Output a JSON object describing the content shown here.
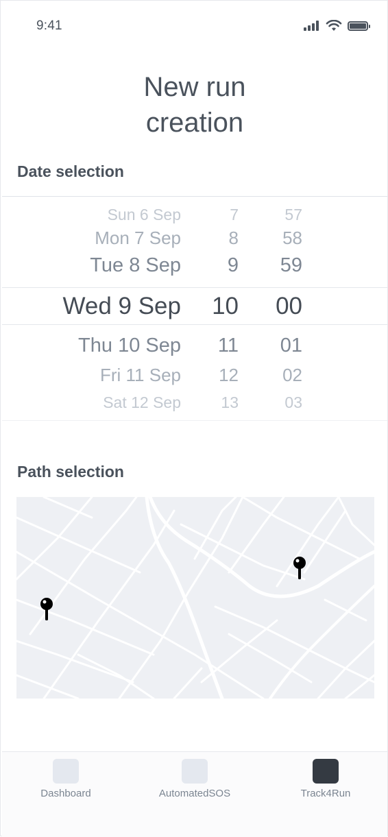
{
  "status_bar": {
    "time": "9:41"
  },
  "header": {
    "title": "New run\ncreation"
  },
  "date_section": {
    "heading": "Date selection"
  },
  "picker": {
    "rows": [
      {
        "date": "Sun 6 Sep",
        "hour": "7",
        "minute": "57",
        "color": "#c3c9d1",
        "size": 23
      },
      {
        "date": "Mon 7 Sep",
        "hour": "8",
        "minute": "58",
        "color": "#a7afb9",
        "size": 26
      },
      {
        "date": "Tue 8 Sep",
        "hour": "9",
        "minute": "59",
        "color": "#7e8793",
        "size": 29
      },
      {
        "date": "Wed 9 Sep",
        "hour": "10",
        "minute": "00",
        "color": "#454c55",
        "size": 35
      },
      {
        "date": "Thu 10 Sep",
        "hour": "11",
        "minute": "01",
        "color": "#7e8793",
        "size": 29
      },
      {
        "date": "Fri 11 Sep",
        "hour": "12",
        "minute": "02",
        "color": "#a7afb9",
        "size": 26
      },
      {
        "date": "Sat 12 Sep",
        "hour": "13",
        "minute": "03",
        "color": "#c3c9d1",
        "size": 23
      }
    ]
  },
  "path_section": {
    "heading": "Path selection"
  },
  "map": {
    "pins": [
      "start-pin",
      "end-pin"
    ]
  },
  "bottom_nav": {
    "items": [
      {
        "label": "Dashboard",
        "icon": "dashboard-icon",
        "active": false
      },
      {
        "label": "AutomatedSOS",
        "icon": "sos-icon",
        "active": false
      },
      {
        "label": "Track4Run",
        "icon": "track-icon",
        "active": true
      }
    ]
  }
}
